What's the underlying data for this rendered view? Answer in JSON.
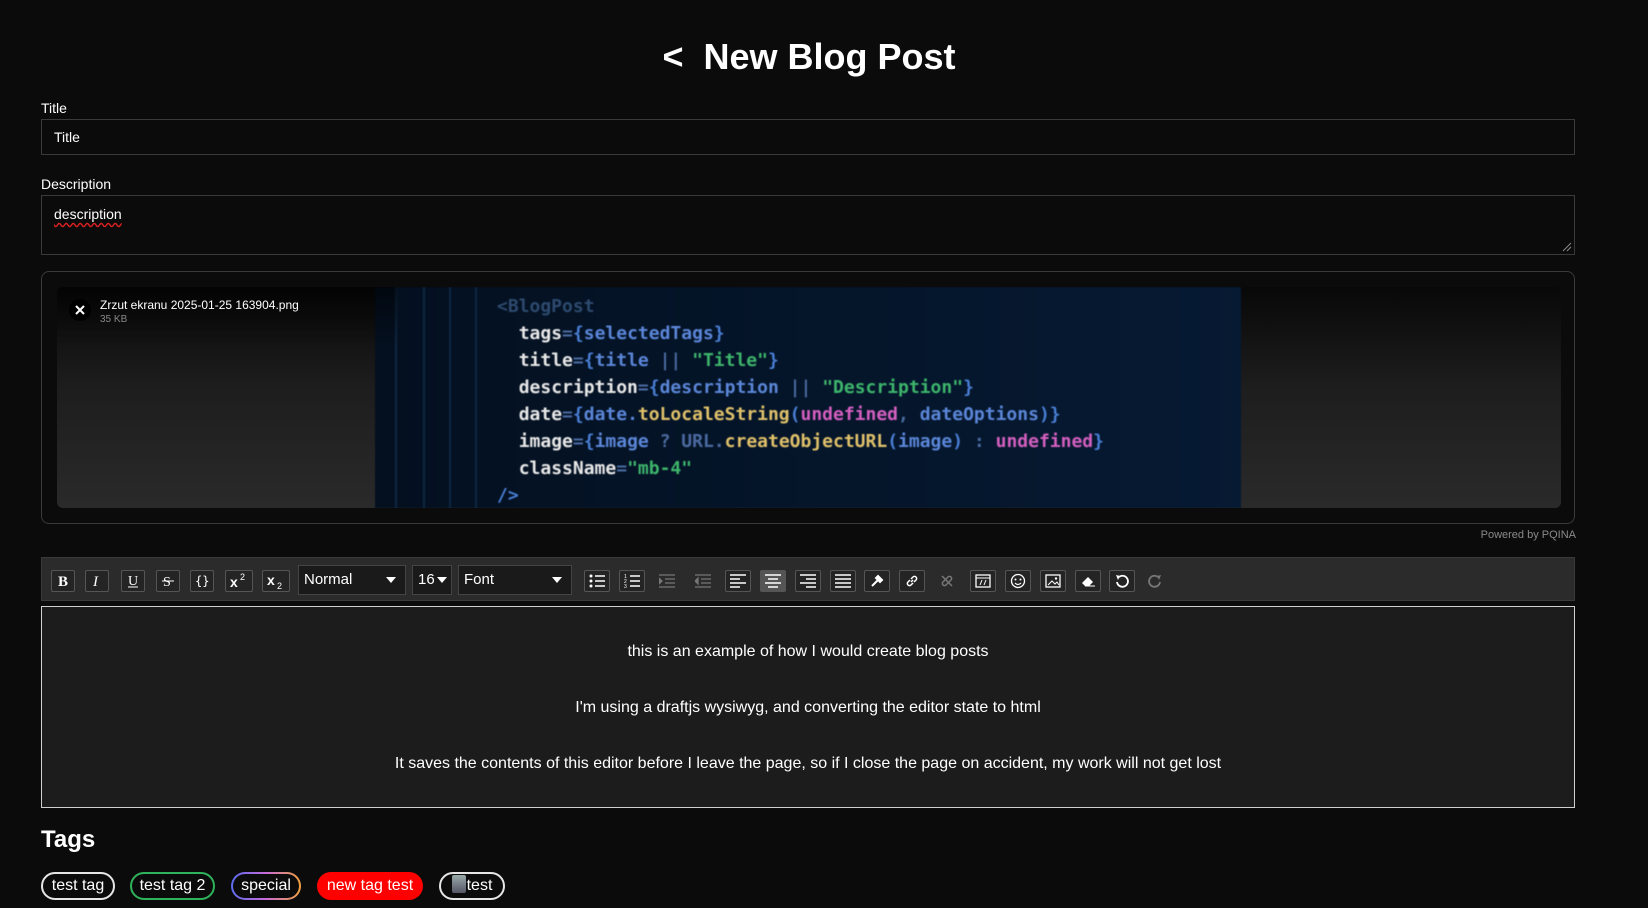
{
  "header": {
    "back": "<",
    "title": "New Blog Post"
  },
  "form": {
    "title_label": "Title",
    "title_value": "Title",
    "description_label": "Description",
    "description_value": "description"
  },
  "upload": {
    "file_name": "Zrzut ekranu 2025-01-25 163904.png",
    "file_size": "35 KB",
    "powered_by": "Powered by PQINA",
    "code_lines": [
      "<BlogPost",
      "  tags={selectedTags}",
      "  title={title || \"Title\"}",
      "  description={description || \"Description\"}",
      "  date={date.toLocaleString(undefined, dateOptions)}",
      "  image={image ? URL.createObjectURL(image) : undefined}",
      "  className=\"mb-4\"",
      "/>"
    ]
  },
  "toolbar": {
    "block_type": "Normal",
    "font_size": "16",
    "font_family": "Font",
    "buttons": [
      "bold",
      "italic",
      "underline",
      "strikethrough",
      "monospace",
      "superscript",
      "subscript",
      "unordered-list",
      "ordered-list",
      "indent",
      "outdent",
      "align-left",
      "align-center",
      "align-right",
      "align-justify",
      "color",
      "link",
      "unlink",
      "embedded",
      "emoji",
      "image",
      "remove",
      "undo",
      "redo"
    ]
  },
  "editor": {
    "paragraphs": [
      "this is an example of how I would create blog posts",
      "I'm using a draftjs wysiwyg, and converting the editor state to html",
      "It saves the contents of this editor before I leave the page, so if I close the page on accident, my work will not get lost"
    ]
  },
  "tags": {
    "title": "Tags",
    "items": [
      {
        "label": "test tag",
        "style": "white"
      },
      {
        "label": "test tag 2",
        "style": "green"
      },
      {
        "label": "special",
        "style": "gradient"
      },
      {
        "label": "new tag test",
        "style": "red"
      },
      {
        "label": "test",
        "style": "white-icon"
      }
    ]
  }
}
